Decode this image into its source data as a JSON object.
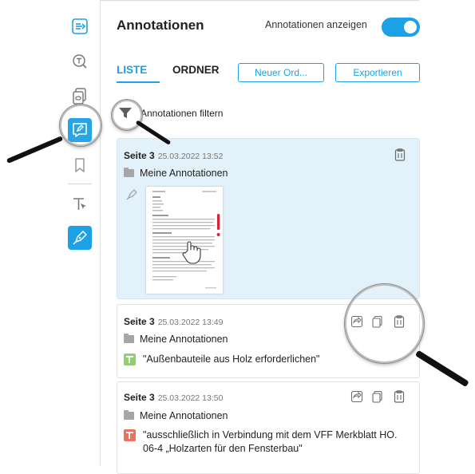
{
  "panel": {
    "title": "Annotationen",
    "toggle_label": "Annotationen anzeigen",
    "toggle_on": true
  },
  "tabs": [
    {
      "label": "LISTE",
      "active": true
    },
    {
      "label": "ORDNER",
      "active": false
    }
  ],
  "buttons": {
    "new_folder": "Neuer Ord...",
    "export": "Exportieren"
  },
  "filter": {
    "label": "Annotationen filtern",
    "icon": "filter-icon"
  },
  "sidebar": {
    "items": [
      {
        "icon": "panel-toggle-icon",
        "active": false
      },
      {
        "icon": "text-search-icon",
        "active": false
      },
      {
        "icon": "pages-icon",
        "active": false
      },
      {
        "icon": "annotations-icon",
        "active": true
      },
      {
        "icon": "bookmark-icon",
        "active": false
      },
      {
        "icon": "text-select-icon",
        "active": false
      },
      {
        "icon": "pen-tool-icon",
        "active": true
      }
    ]
  },
  "annotations": [
    {
      "page": "Seite 3",
      "date": "25.03.2022 13:52",
      "folder": "Meine Annotationen",
      "type": "signature",
      "selected": true
    },
    {
      "page": "Seite 3",
      "date": "25.03.2022 13:49",
      "folder": "Meine Annotationen",
      "type": "highlight",
      "color": "#8fd16a",
      "text": "\"Außenbauteile aus Holz erforderlichen\""
    },
    {
      "page": "Seite 3",
      "date": "25.03.2022 13:50",
      "folder": "Meine Annotationen",
      "type": "highlight",
      "color": "#e8735e",
      "text": "\"ausschließlich in Verbindung mit dem VFF Merkblatt HO. 06-4 „Holzarten für den Fensterbau\""
    }
  ],
  "colors": {
    "accent": "#1da1e6",
    "selected_card": "#e3f1fa",
    "thumbnail_mark": "#d9253a"
  }
}
